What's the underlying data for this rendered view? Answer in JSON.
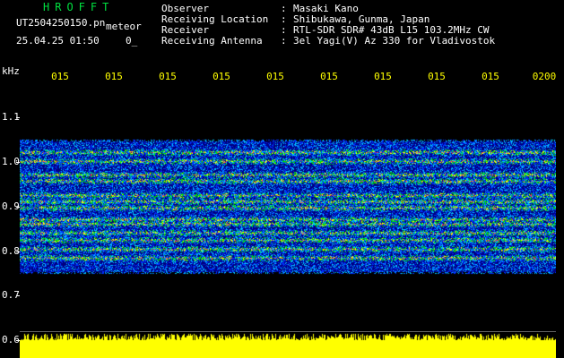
{
  "app": {
    "title": "HROFFT"
  },
  "file": {
    "name": "UT2504250150.pn",
    "mode": "meteor",
    "datetime": "25.04.25 01:50",
    "progress": "0_"
  },
  "info": [
    {
      "label": "Observer",
      "value": "Masaki Kano"
    },
    {
      "label": "Receiving Location",
      "value": "Shibukawa, Gunma, Japan"
    },
    {
      "label": "Receiver",
      "value": "RTL-SDR SDR# 43dB L15 103.2MHz CW"
    },
    {
      "label": "Receiving Antenna",
      "value": "3el Yagi(V) Az 330 for Vladivostok"
    }
  ],
  "axis": {
    "unit": "kHz",
    "time_ticks": [
      "015",
      "015",
      "015",
      "015",
      "015",
      "015",
      "015",
      "015",
      "015",
      "0200"
    ],
    "freq_ticks": [
      "1.1",
      "1.0",
      "0.9",
      "0.8",
      "0.7",
      "0.6"
    ]
  },
  "colors": {
    "title": "#00e040",
    "time_ticks": "#ffff00",
    "signal_bar": "#ffff00"
  }
}
